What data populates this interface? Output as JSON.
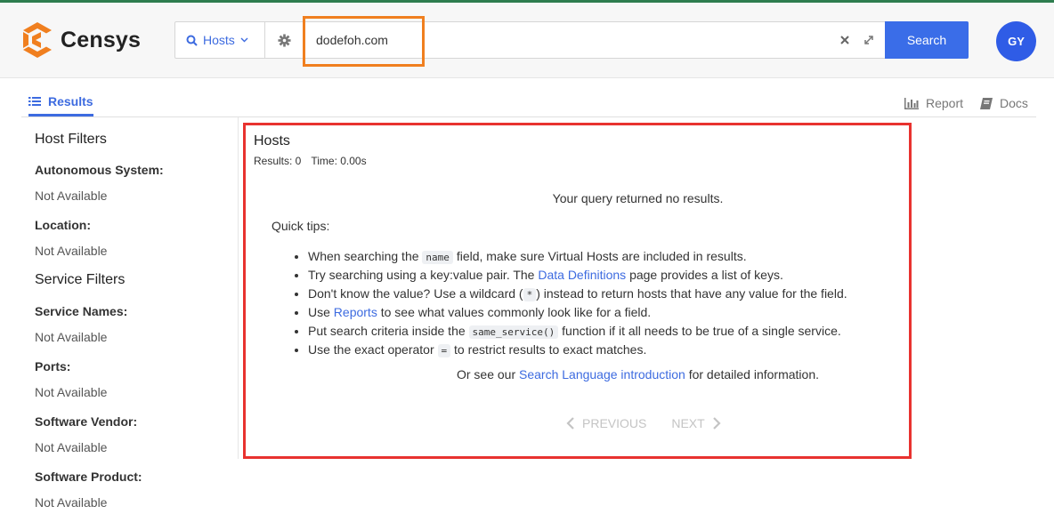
{
  "app": {
    "name": "Censys",
    "colors": {
      "accent": "#3a6de8",
      "brand_orange": "#f07f1f",
      "highlight_red": "#e8322f"
    }
  },
  "search": {
    "type_label": "Hosts",
    "query": "dodefoh.com",
    "button_label": "Search",
    "icons": {
      "type": "search-icon",
      "settings": "gear-icon",
      "clear": "close-icon",
      "expand": "expand-icon"
    }
  },
  "user": {
    "initials": "GY"
  },
  "tabs": {
    "results": "Results",
    "report": "Report",
    "docs": "Docs"
  },
  "sidebar": {
    "host_filters_title": "Host Filters",
    "host_filters": [
      {
        "label": "Autonomous System:",
        "value": "Not Available"
      },
      {
        "label": "Location:",
        "value": "Not Available"
      }
    ],
    "service_filters_title": "Service Filters",
    "service_filters": [
      {
        "label": "Service Names:",
        "value": "Not Available"
      },
      {
        "label": "Ports:",
        "value": "Not Available"
      },
      {
        "label": "Software Vendor:",
        "value": "Not Available"
      },
      {
        "label": "Software Product:",
        "value": "Not Available"
      }
    ]
  },
  "results": {
    "title": "Hosts",
    "results_count": "Results: 0",
    "time": "Time: 0.00s",
    "no_results": "Your query returned no results.",
    "quick_tips_title": "Quick tips:",
    "tips": {
      "t1_a": "When searching the",
      "t1_code": "name",
      "t1_b": "field, make sure Virtual Hosts are included in results.",
      "t2_a": "Try searching using a key:value pair. The",
      "t2_link": "Data Definitions",
      "t2_b": "page provides a list of keys.",
      "t3_a": "Don't know the value? Use a wildcard (",
      "t3_code": "*",
      "t3_b": ") instead to return hosts that have any value for the field.",
      "t4_a": "Use",
      "t4_link": "Reports",
      "t4_b": "to see what values commonly look like for a field.",
      "t5_a": "Put search criteria inside the",
      "t5_code": "same_service()",
      "t5_b": "function if it all needs to be true of a single service.",
      "t6_a": "Use the exact operator",
      "t6_code": "=",
      "t6_b": "to restrict results to exact matches."
    },
    "see_our_a": "Or see our",
    "see_our_link": "Search Language introduction",
    "see_our_b": "for detailed information.",
    "pager": {
      "previous": "PREVIOUS",
      "next": "NEXT"
    }
  }
}
